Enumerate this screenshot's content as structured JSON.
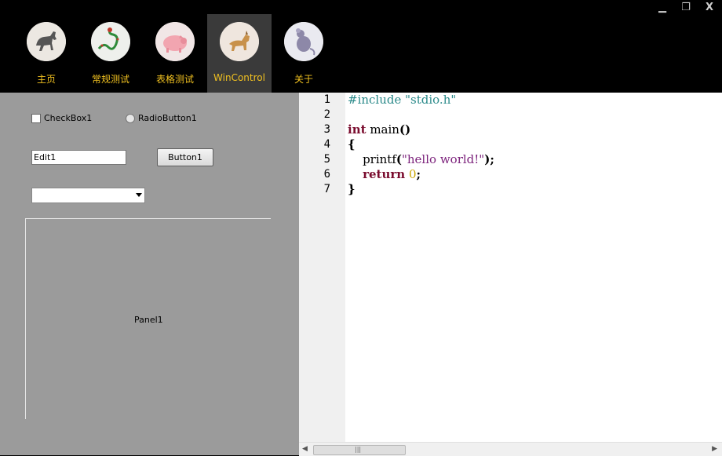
{
  "window": {
    "min_glyph": "▁",
    "max_glyph": "❐",
    "close_glyph": "X"
  },
  "nav": {
    "items": [
      {
        "label": "主页",
        "icon": "horse-icon"
      },
      {
        "label": "常规测试",
        "icon": "dragon-icon"
      },
      {
        "label": "表格测试",
        "icon": "pig-icon"
      },
      {
        "label": "WinControl",
        "icon": "dog-icon",
        "active": true
      },
      {
        "label": "关于",
        "icon": "rat-icon"
      }
    ]
  },
  "left_panel": {
    "checkbox_label": "CheckBox1",
    "radio_label": "RadioButton1",
    "edit_value": "Edit1",
    "button_label": "Button1",
    "combo_value": "",
    "panel_label": "Panel1"
  },
  "editor": {
    "line_numbers": [
      "1",
      "2",
      "3",
      "4",
      "5",
      "6",
      "7"
    ],
    "lines": [
      "#include \"stdio.h\"",
      "",
      "int main()",
      "{",
      "    printf(\"hello world!\");",
      "    return 0;",
      "}"
    ]
  },
  "colors": {
    "nav_label": "#f0c020",
    "left_bg": "#9b9b9b",
    "keyword": "#7a0c2e",
    "preprocessor": "#2b8a8a",
    "string": "#7a1f7a",
    "number": "#c9a500"
  }
}
